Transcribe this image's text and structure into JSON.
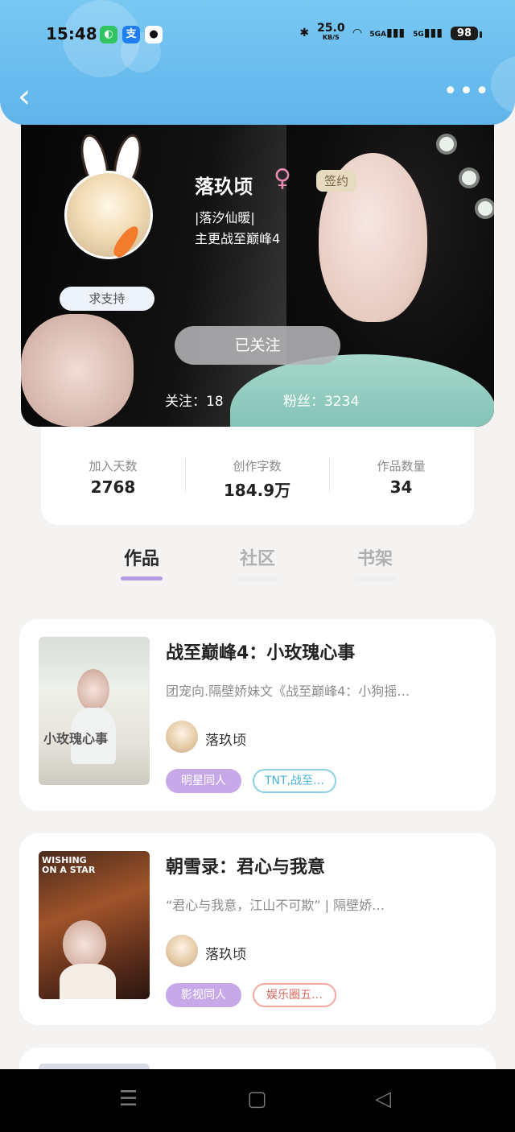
{
  "status_bar": {
    "time": "15:48",
    "apps": [
      "wechat-icon",
      "alipay-icon",
      "qq-icon"
    ],
    "alipay_glyph": "支",
    "speed_value": "25.0",
    "speed_unit": "KB/S",
    "net1": "5GA",
    "net2": "5G",
    "battery": "98"
  },
  "header": {
    "back_icon": "‹",
    "more_icon": "•••"
  },
  "profile": {
    "name": "落玖顷",
    "gender_icon": "♀",
    "sign_badge": "签约",
    "bio_line1": "|落汐仙暖|",
    "bio_line2": "主更战至巅峰4",
    "support_label": "求支持",
    "follow_button": "已关注",
    "following": "关注：18",
    "fans": "粉丝：3234"
  },
  "stats": [
    {
      "label": "加入天数",
      "value": "2768"
    },
    {
      "label": "创作字数",
      "value": "184.9万"
    },
    {
      "label": "作品数量",
      "value": "34"
    }
  ],
  "tabs": [
    {
      "label": "作品",
      "active": true
    },
    {
      "label": "社区",
      "active": false
    },
    {
      "label": "书架",
      "active": false
    }
  ],
  "books": [
    {
      "title": "战至巅峰4：小玫瑰心事",
      "desc": "团宠向.隔壁娇妹文《战至巅峰4：小狗摇…",
      "author": "落玖顷",
      "tags": [
        "明星同人",
        "TNT,战至…"
      ],
      "cover_text": "小玫瑰心事"
    },
    {
      "title": "朝雪录：君心与我意",
      "desc": "“君心与我意，江山不可欺” | 隔壁娇…",
      "author": "落玖顷",
      "tags": [
        "影视同人",
        "娱乐圈五…"
      ],
      "cover_text": "WISHING ON A STAR"
    }
  ],
  "nav": {
    "menu_icon": "☰",
    "home_icon": "▢",
    "back_icon": "◁"
  }
}
